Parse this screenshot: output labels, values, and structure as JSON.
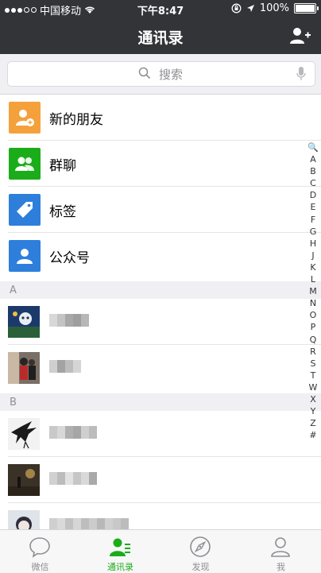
{
  "status_bar": {
    "carrier": "中国移动",
    "time": "下午8:47",
    "battery": "100%"
  },
  "nav": {
    "title": "通讯录"
  },
  "search": {
    "placeholder": "搜索"
  },
  "menu_items": [
    {
      "label": "新的朋友",
      "color": "#f4a13b",
      "icon": "new-friend-icon"
    },
    {
      "label": "群聊",
      "color": "#1aad19",
      "icon": "group-chat-icon"
    },
    {
      "label": "标签",
      "color": "#2e7fdb",
      "icon": "tag-icon"
    },
    {
      "label": "公众号",
      "color": "#2e7fdb",
      "icon": "official-account-icon"
    }
  ],
  "sections": [
    {
      "letter": "A"
    },
    {
      "letter": "B"
    }
  ],
  "index_letters": [
    "🔍",
    "A",
    "B",
    "C",
    "D",
    "E",
    "F",
    "G",
    "H",
    "J",
    "K",
    "L",
    "M",
    "N",
    "O",
    "P",
    "Q",
    "R",
    "S",
    "T",
    "W",
    "X",
    "Y",
    "Z",
    "#"
  ],
  "tabs": [
    {
      "label": "微信",
      "icon": "chat-bubble-icon",
      "active": false
    },
    {
      "label": "通讯录",
      "icon": "contacts-icon",
      "active": true
    },
    {
      "label": "发现",
      "icon": "compass-icon",
      "active": false
    },
    {
      "label": "我",
      "icon": "person-icon",
      "active": false
    }
  ]
}
